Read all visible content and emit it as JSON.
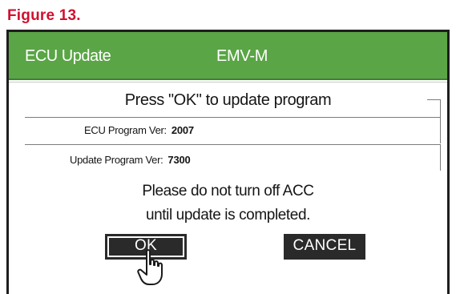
{
  "figure_label": "Figure 13.",
  "screen": {
    "title_left": "ECU Update",
    "title_right": "EMV-M",
    "prompt": "Press \"OK\" to update program",
    "ecu_version": {
      "label": "ECU Program Ver:",
      "value": "2007"
    },
    "update_version": {
      "label": "Update Program Ver:",
      "value": "7300"
    },
    "warning_line1": "Please do not turn off ACC",
    "warning_line2": "until update is completed.",
    "ok_label": "OK",
    "cancel_label": "CANCEL"
  },
  "colors": {
    "figure_label": "#d0102f",
    "titlebar": "#5aa545",
    "button": "#2a2a2a"
  },
  "icons": {
    "pointer": "hand-pointer-icon"
  }
}
